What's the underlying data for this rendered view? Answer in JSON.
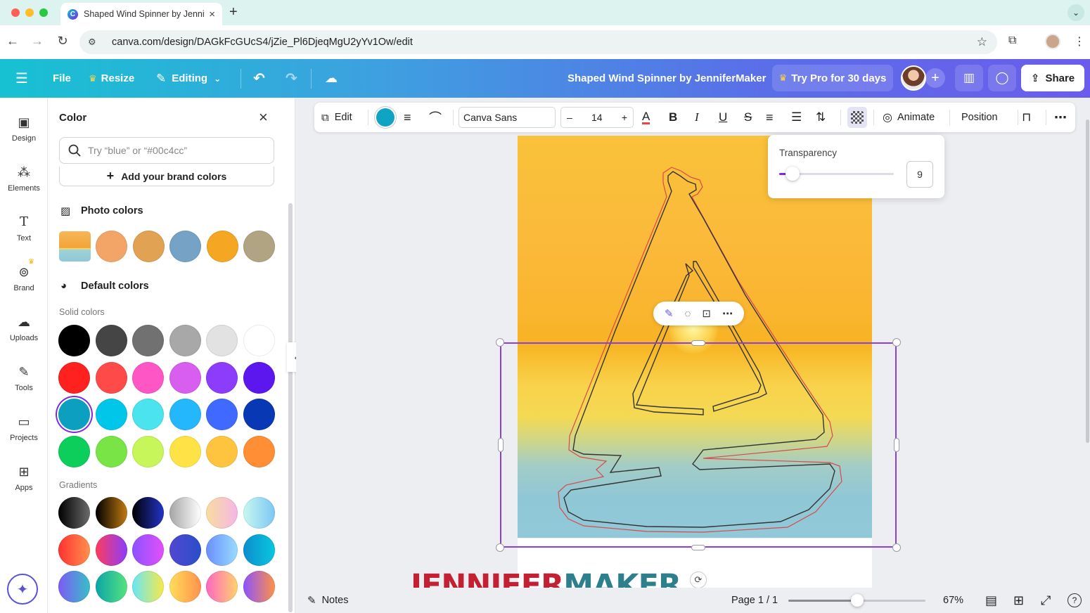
{
  "browser": {
    "tab_title": "Shaped Wind Spinner by JenniferMaker",
    "tab_favicon_letter": "C",
    "url": "canva.com/design/DAGkFcGUcS4/jZie_Pl6DjeqMgU2yYv1Ow/edit"
  },
  "header": {
    "file": "File",
    "resize": "Resize",
    "editing": "Editing",
    "doc_title": "Shaped Wind Spinner by JenniferMaker",
    "try_pro": "Try Pro for 30 days",
    "share": "Share"
  },
  "rail": [
    {
      "label": "Design",
      "icon": "design-icon"
    },
    {
      "label": "Elements",
      "icon": "elements-icon"
    },
    {
      "label": "Text",
      "icon": "text-icon"
    },
    {
      "label": "Brand",
      "icon": "brand-icon"
    },
    {
      "label": "Uploads",
      "icon": "uploads-icon"
    },
    {
      "label": "Tools",
      "icon": "tools-icon"
    },
    {
      "label": "Projects",
      "icon": "projects-icon"
    },
    {
      "label": "Apps",
      "icon": "apps-icon"
    }
  ],
  "panel": {
    "title": "Color",
    "search_placeholder": "Try “blue” or “#00c4cc”",
    "add_brand": "Add your brand colors",
    "photo_colors_title": "Photo colors",
    "photo_colors": [
      "#f3a568",
      "#e1a253",
      "#76a3c5",
      "#f5a623",
      "#b1a482"
    ],
    "default_colors_title": "Default colors",
    "solid_label": "Solid colors",
    "solid_colors": [
      "#000000",
      "#454545",
      "#717171",
      "#a8a8a8",
      "#e2e2e2",
      "#ffffff",
      "#ff2020",
      "#ff4a4a",
      "#ff56c6",
      "#d85ef0",
      "#8c3dfb",
      "#5c17ee",
      "#0d9fbf",
      "#00c7ea",
      "#4be4ee",
      "#24b7fb",
      "#4069ff",
      "#0838b3",
      "#0ccf5b",
      "#79e445",
      "#c6f659",
      "#ffe346",
      "#ffc43f",
      "#ff8e34"
    ],
    "selected_index": 12,
    "gradients_label": "Gradients",
    "gradients": [
      "linear-gradient(90deg,#000,#6b6b6b)",
      "linear-gradient(90deg,#000,#c27a11)",
      "linear-gradient(90deg,#000,#2434c9)",
      "linear-gradient(90deg,#a5a5a5,#fff)",
      "linear-gradient(90deg,#f8dd9f,#f5b6e6)",
      "linear-gradient(90deg,#c8f7ef,#7cc7f4)",
      "linear-gradient(90deg,#ff3131,#ff914d)",
      "linear-gradient(90deg,#ff3c5c,#8b3dfd)",
      "linear-gradient(90deg,#8c52ff,#e34ffb)",
      "linear-gradient(90deg,#5247d1,#2a4ec9)",
      "linear-gradient(90deg,#6a8eff,#98dcff)",
      "linear-gradient(90deg,#0d8dcd,#08c7e0)",
      "linear-gradient(90deg,#7f59f5,#37c0c7)",
      "linear-gradient(90deg,#0aa5a8,#57e37e)",
      "linear-gradient(90deg,#67e6f6,#f7e94a)",
      "linear-gradient(90deg,#ffde59,#ff914d)",
      "linear-gradient(90deg,#ff66c4,#ffd36b)",
      "linear-gradient(90deg,#8c52ff,#ff9147)"
    ]
  },
  "toolbar": {
    "edit": "Edit",
    "font": "Canva Sans",
    "size": "14",
    "minus": "–",
    "plus": "+",
    "animate": "Animate",
    "position": "Position",
    "text_color_letter": "A",
    "bold": "B",
    "italic": "I",
    "underline": "U",
    "strike": "S"
  },
  "transparency": {
    "label": "Transparency",
    "value": "9",
    "fraction": 0.09
  },
  "bottom": {
    "notes": "Notes",
    "page": "Page 1 / 1",
    "zoom": "67%",
    "zoom_fraction": 0.5
  },
  "watermark": {
    "part1": "JENNIFER",
    "part2": "MAKER"
  }
}
